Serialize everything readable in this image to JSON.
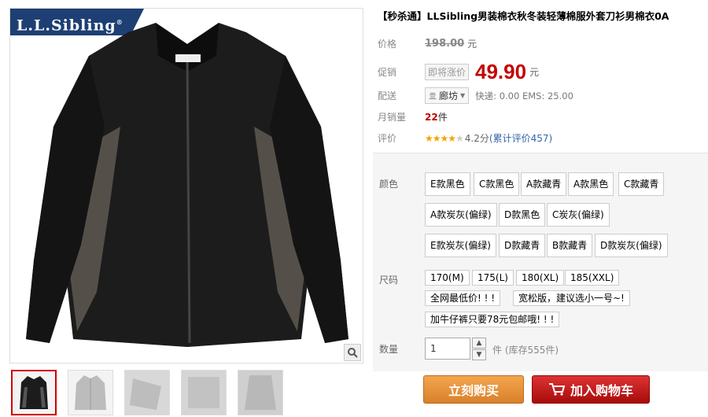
{
  "brand": {
    "logo_text": "L.L.Sibling",
    "logo_mark": "®"
  },
  "product": {
    "title_tag": "【秒杀通】",
    "title": "LLSibling男装棉衣秋冬装轻薄棉服外套刀衫男棉衣0A"
  },
  "price": {
    "label": "价格",
    "original": "198.00",
    "unit": "元"
  },
  "promo": {
    "label": "促销",
    "tag": "即将涨价",
    "price": "49.90",
    "unit": "元"
  },
  "delivery": {
    "label": "配送",
    "location": "廊坊",
    "shipping": "快递: 0.00 EMS: 25.00"
  },
  "monthly_sales": {
    "label": "月销量",
    "count": "22",
    "unit": "件"
  },
  "rating": {
    "label": "评价",
    "stars": 4.2,
    "score": "4.2分",
    "reviews": "(累计评价457)"
  },
  "colors": {
    "label": "颜色",
    "options": [
      "E款黑色",
      "C款黑色",
      "A款藏青",
      "A款黑色",
      "C款藏青",
      "A款炭灰(偏绿)",
      "D款黑色",
      "C炭灰(偏绿)",
      "E款炭灰(偏绿)",
      "D款藏青",
      "B款藏青",
      "D款炭灰(偏绿)"
    ]
  },
  "sizes": {
    "label": "尺码",
    "options": [
      "170(M)",
      "175(L)",
      "180(XL)",
      "185(XXL)",
      "全网最低价! ! !",
      "宽松版，建议选小一号~!",
      "加牛仔裤只要78元包邮哦! ! !"
    ]
  },
  "quantity": {
    "label": "数量",
    "value": "1",
    "unit": "件",
    "stock": "(库存555件)"
  },
  "buttons": {
    "buy_now": "立刻购买",
    "add_cart": "加入购物车"
  },
  "icons": {
    "zoom": "magnifier-icon",
    "cart": "cart-icon",
    "location": "location-icon"
  },
  "theme": {
    "brand_blue": "#1d3f73",
    "price_red": "#c40000",
    "buy_orange": "#e08a33",
    "cart_red": "#c01414"
  }
}
